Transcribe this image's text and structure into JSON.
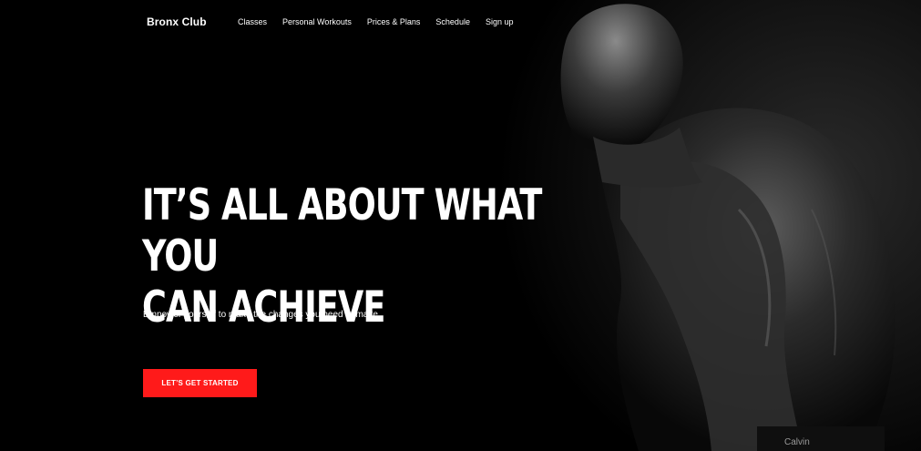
{
  "brand": {
    "name": "Bronx Club"
  },
  "nav": {
    "items": [
      {
        "label": "Classes"
      },
      {
        "label": "Personal Workouts"
      },
      {
        "label": "Prices & Plans"
      },
      {
        "label": "Schedule"
      },
      {
        "label": "Sign up"
      }
    ]
  },
  "hero": {
    "headline_line1": "IT’S ALL ABOUT WHAT YOU",
    "headline_line2": "CAN ACHIEVE",
    "subheadline": "Empower yourself to make the changes you need to make",
    "cta_label": "LET’S GET STARTED",
    "waistband_text": "Calvin"
  },
  "colors": {
    "background": "#000000",
    "text": "#ffffff",
    "accent": "#ff1a1a"
  }
}
